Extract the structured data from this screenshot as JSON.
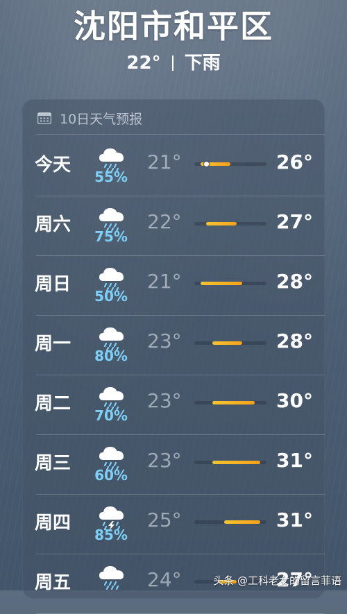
{
  "location": "沈阳市和平区",
  "current": {
    "temp": "22°",
    "condition": "下雨"
  },
  "panel": {
    "title": "10日天气预报",
    "icon": "calendar-icon"
  },
  "colors": {
    "precip": "#7fd0f8",
    "bar_start": "#f6c430",
    "bar_end": "#f6a21b"
  },
  "forecast": [
    {
      "day": "今天",
      "icon": "rain-cloud-icon",
      "precip": "55%",
      "low": "21°",
      "high": "26°",
      "range": [
        21,
        26
      ],
      "current_marker": 22
    },
    {
      "day": "周六",
      "icon": "rain-cloud-icon",
      "precip": "75%",
      "low": "22°",
      "high": "27°",
      "range": [
        22,
        27
      ]
    },
    {
      "day": "周日",
      "icon": "rain-cloud-icon",
      "precip": "50%",
      "low": "21°",
      "high": "28°",
      "range": [
        21,
        28
      ]
    },
    {
      "day": "周一",
      "icon": "rain-cloud-icon",
      "precip": "80%",
      "low": "23°",
      "high": "28°",
      "range": [
        23,
        28
      ]
    },
    {
      "day": "周二",
      "icon": "rain-cloud-icon",
      "precip": "70%",
      "low": "23°",
      "high": "30°",
      "range": [
        23,
        30
      ]
    },
    {
      "day": "周三",
      "icon": "rain-cloud-icon",
      "precip": "60%",
      "low": "23°",
      "high": "31°",
      "range": [
        23,
        31
      ]
    },
    {
      "day": "周四",
      "icon": "thunderstorm-icon",
      "precip": "85%",
      "low": "25°",
      "high": "31°",
      "range": [
        25,
        31
      ]
    },
    {
      "day": "周五",
      "icon": "rain-cloud-icon",
      "precip": "",
      "low": "24°",
      "high": "27°",
      "range": [
        24,
        27
      ]
    }
  ],
  "scale": {
    "min": 20,
    "max": 32
  },
  "watermark": "头条 @工科老女的留言菲语"
}
